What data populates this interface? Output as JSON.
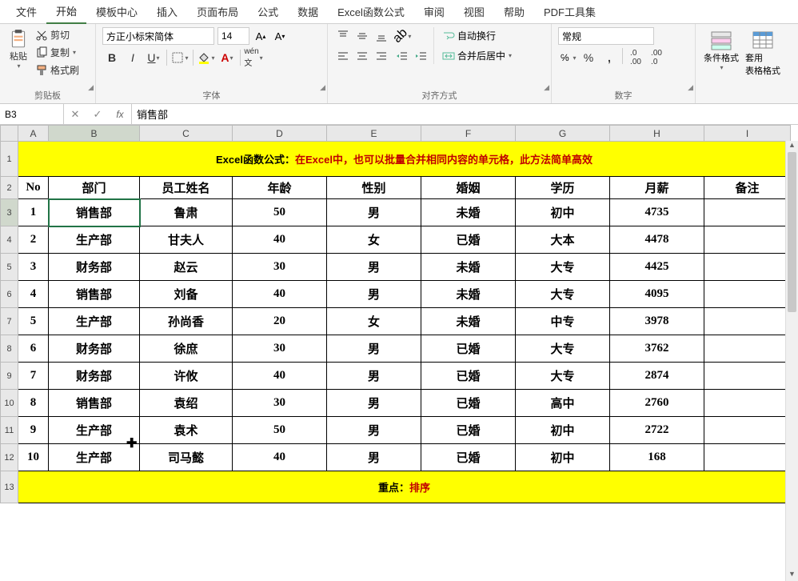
{
  "menu": {
    "items": [
      "文件",
      "开始",
      "模板中心",
      "插入",
      "页面布局",
      "公式",
      "数据",
      "Excel函数公式",
      "审阅",
      "视图",
      "帮助",
      "PDF工具集"
    ],
    "active_index": 1
  },
  "ribbon": {
    "clipboard": {
      "paste": "粘贴",
      "cut": "剪切",
      "copy": "复制",
      "format_painter": "格式刷",
      "label": "剪贴板"
    },
    "font": {
      "name": "方正小标宋简体",
      "size": "14",
      "label": "字体"
    },
    "align": {
      "wrap": "自动换行",
      "merge": "合并后居中",
      "label": "对齐方式"
    },
    "number": {
      "format": "常规",
      "label": "数字"
    },
    "styles": {
      "cond_format": "条件格式",
      "table_format": "套用\n表格格式"
    }
  },
  "name_box": "B3",
  "formula_value": "销售部",
  "columns": [
    "A",
    "B",
    "C",
    "D",
    "E",
    "F",
    "G",
    "H",
    "I"
  ],
  "row_nums": [
    "1",
    "2",
    "3",
    "4",
    "5",
    "6",
    "7",
    "8",
    "9",
    "10",
    "11",
    "12",
    "13"
  ],
  "title": {
    "prefix": "Excel函数公式：",
    "body": "在Excel中，也可以批量合并相同内容的单元格，此方法简单高效"
  },
  "headers": [
    "No",
    "部门",
    "员工姓名",
    "年龄",
    "性别",
    "婚姻",
    "学历",
    "月薪",
    "备注"
  ],
  "rows": [
    {
      "no": "1",
      "dept": "销售部",
      "name": "鲁肃",
      "age": "50",
      "sex": "男",
      "mar": "未婚",
      "edu": "初中",
      "sal": "4735",
      "note": ""
    },
    {
      "no": "2",
      "dept": "生产部",
      "name": "甘夫人",
      "age": "40",
      "sex": "女",
      "mar": "已婚",
      "edu": "大本",
      "sal": "4478",
      "note": ""
    },
    {
      "no": "3",
      "dept": "财务部",
      "name": "赵云",
      "age": "30",
      "sex": "男",
      "mar": "未婚",
      "edu": "大专",
      "sal": "4425",
      "note": ""
    },
    {
      "no": "4",
      "dept": "销售部",
      "name": "刘备",
      "age": "40",
      "sex": "男",
      "mar": "未婚",
      "edu": "大专",
      "sal": "4095",
      "note": ""
    },
    {
      "no": "5",
      "dept": "生产部",
      "name": "孙尚香",
      "age": "20",
      "sex": "女",
      "mar": "未婚",
      "edu": "中专",
      "sal": "3978",
      "note": ""
    },
    {
      "no": "6",
      "dept": "财务部",
      "name": "徐庶",
      "age": "30",
      "sex": "男",
      "mar": "已婚",
      "edu": "大专",
      "sal": "3762",
      "note": ""
    },
    {
      "no": "7",
      "dept": "财务部",
      "name": "许攸",
      "age": "40",
      "sex": "男",
      "mar": "已婚",
      "edu": "大专",
      "sal": "2874",
      "note": ""
    },
    {
      "no": "8",
      "dept": "销售部",
      "name": "袁绍",
      "age": "30",
      "sex": "男",
      "mar": "已婚",
      "edu": "高中",
      "sal": "2760",
      "note": ""
    },
    {
      "no": "9",
      "dept": "生产部",
      "name": "袁术",
      "age": "50",
      "sex": "男",
      "mar": "已婚",
      "edu": "初中",
      "sal": "2722",
      "note": ""
    },
    {
      "no": "10",
      "dept": "生产部",
      "name": "司马懿",
      "age": "40",
      "sex": "男",
      "mar": "已婚",
      "edu": "初中",
      "sal": "168",
      "note": ""
    }
  ],
  "footer": {
    "prefix": "重点：",
    "body": "排序"
  }
}
